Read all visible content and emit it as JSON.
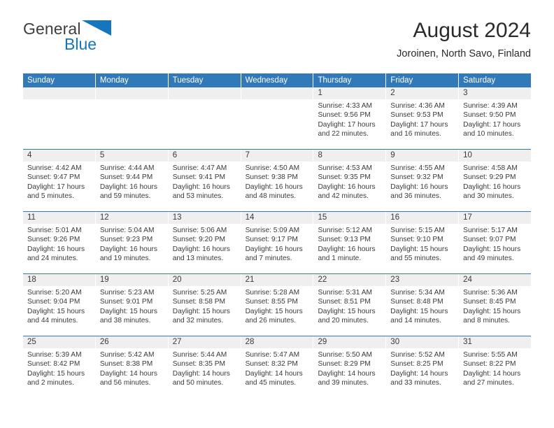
{
  "brand": {
    "name_part1": "General",
    "name_part2": "Blue",
    "triangle_color": "#1576bc"
  },
  "header": {
    "month_title": "August 2024",
    "location": "Joroinen, North Savo, Finland"
  },
  "theme": {
    "header_blue": "#3179b8",
    "daynum_band": "#efefef",
    "text": "#3a3a3a"
  },
  "weekdays": [
    "Sunday",
    "Monday",
    "Tuesday",
    "Wednesday",
    "Thursday",
    "Friday",
    "Saturday"
  ],
  "weeks": [
    [
      {
        "day": "",
        "empty": true
      },
      {
        "day": "",
        "empty": true
      },
      {
        "day": "",
        "empty": true
      },
      {
        "day": "",
        "empty": true
      },
      {
        "day": "1",
        "sunrise": "Sunrise: 4:33 AM",
        "sunset": "Sunset: 9:56 PM",
        "daylight": "Daylight: 17 hours and 22 minutes."
      },
      {
        "day": "2",
        "sunrise": "Sunrise: 4:36 AM",
        "sunset": "Sunset: 9:53 PM",
        "daylight": "Daylight: 17 hours and 16 minutes."
      },
      {
        "day": "3",
        "sunrise": "Sunrise: 4:39 AM",
        "sunset": "Sunset: 9:50 PM",
        "daylight": "Daylight: 17 hours and 10 minutes."
      }
    ],
    [
      {
        "day": "4",
        "sunrise": "Sunrise: 4:42 AM",
        "sunset": "Sunset: 9:47 PM",
        "daylight": "Daylight: 17 hours and 5 minutes."
      },
      {
        "day": "5",
        "sunrise": "Sunrise: 4:44 AM",
        "sunset": "Sunset: 9:44 PM",
        "daylight": "Daylight: 16 hours and 59 minutes."
      },
      {
        "day": "6",
        "sunrise": "Sunrise: 4:47 AM",
        "sunset": "Sunset: 9:41 PM",
        "daylight": "Daylight: 16 hours and 53 minutes."
      },
      {
        "day": "7",
        "sunrise": "Sunrise: 4:50 AM",
        "sunset": "Sunset: 9:38 PM",
        "daylight": "Daylight: 16 hours and 48 minutes."
      },
      {
        "day": "8",
        "sunrise": "Sunrise: 4:53 AM",
        "sunset": "Sunset: 9:35 PM",
        "daylight": "Daylight: 16 hours and 42 minutes."
      },
      {
        "day": "9",
        "sunrise": "Sunrise: 4:55 AM",
        "sunset": "Sunset: 9:32 PM",
        "daylight": "Daylight: 16 hours and 36 minutes."
      },
      {
        "day": "10",
        "sunrise": "Sunrise: 4:58 AM",
        "sunset": "Sunset: 9:29 PM",
        "daylight": "Daylight: 16 hours and 30 minutes."
      }
    ],
    [
      {
        "day": "11",
        "sunrise": "Sunrise: 5:01 AM",
        "sunset": "Sunset: 9:26 PM",
        "daylight": "Daylight: 16 hours and 24 minutes."
      },
      {
        "day": "12",
        "sunrise": "Sunrise: 5:04 AM",
        "sunset": "Sunset: 9:23 PM",
        "daylight": "Daylight: 16 hours and 19 minutes."
      },
      {
        "day": "13",
        "sunrise": "Sunrise: 5:06 AM",
        "sunset": "Sunset: 9:20 PM",
        "daylight": "Daylight: 16 hours and 13 minutes."
      },
      {
        "day": "14",
        "sunrise": "Sunrise: 5:09 AM",
        "sunset": "Sunset: 9:17 PM",
        "daylight": "Daylight: 16 hours and 7 minutes."
      },
      {
        "day": "15",
        "sunrise": "Sunrise: 5:12 AM",
        "sunset": "Sunset: 9:13 PM",
        "daylight": "Daylight: 16 hours and 1 minute."
      },
      {
        "day": "16",
        "sunrise": "Sunrise: 5:15 AM",
        "sunset": "Sunset: 9:10 PM",
        "daylight": "Daylight: 15 hours and 55 minutes."
      },
      {
        "day": "17",
        "sunrise": "Sunrise: 5:17 AM",
        "sunset": "Sunset: 9:07 PM",
        "daylight": "Daylight: 15 hours and 49 minutes."
      }
    ],
    [
      {
        "day": "18",
        "sunrise": "Sunrise: 5:20 AM",
        "sunset": "Sunset: 9:04 PM",
        "daylight": "Daylight: 15 hours and 44 minutes."
      },
      {
        "day": "19",
        "sunrise": "Sunrise: 5:23 AM",
        "sunset": "Sunset: 9:01 PM",
        "daylight": "Daylight: 15 hours and 38 minutes."
      },
      {
        "day": "20",
        "sunrise": "Sunrise: 5:25 AM",
        "sunset": "Sunset: 8:58 PM",
        "daylight": "Daylight: 15 hours and 32 minutes."
      },
      {
        "day": "21",
        "sunrise": "Sunrise: 5:28 AM",
        "sunset": "Sunset: 8:55 PM",
        "daylight": "Daylight: 15 hours and 26 minutes."
      },
      {
        "day": "22",
        "sunrise": "Sunrise: 5:31 AM",
        "sunset": "Sunset: 8:51 PM",
        "daylight": "Daylight: 15 hours and 20 minutes."
      },
      {
        "day": "23",
        "sunrise": "Sunrise: 5:34 AM",
        "sunset": "Sunset: 8:48 PM",
        "daylight": "Daylight: 15 hours and 14 minutes."
      },
      {
        "day": "24",
        "sunrise": "Sunrise: 5:36 AM",
        "sunset": "Sunset: 8:45 PM",
        "daylight": "Daylight: 15 hours and 8 minutes."
      }
    ],
    [
      {
        "day": "25",
        "sunrise": "Sunrise: 5:39 AM",
        "sunset": "Sunset: 8:42 PM",
        "daylight": "Daylight: 15 hours and 2 minutes."
      },
      {
        "day": "26",
        "sunrise": "Sunrise: 5:42 AM",
        "sunset": "Sunset: 8:38 PM",
        "daylight": "Daylight: 14 hours and 56 minutes."
      },
      {
        "day": "27",
        "sunrise": "Sunrise: 5:44 AM",
        "sunset": "Sunset: 8:35 PM",
        "daylight": "Daylight: 14 hours and 50 minutes."
      },
      {
        "day": "28",
        "sunrise": "Sunrise: 5:47 AM",
        "sunset": "Sunset: 8:32 PM",
        "daylight": "Daylight: 14 hours and 45 minutes."
      },
      {
        "day": "29",
        "sunrise": "Sunrise: 5:50 AM",
        "sunset": "Sunset: 8:29 PM",
        "daylight": "Daylight: 14 hours and 39 minutes."
      },
      {
        "day": "30",
        "sunrise": "Sunrise: 5:52 AM",
        "sunset": "Sunset: 8:25 PM",
        "daylight": "Daylight: 14 hours and 33 minutes."
      },
      {
        "day": "31",
        "sunrise": "Sunrise: 5:55 AM",
        "sunset": "Sunset: 8:22 PM",
        "daylight": "Daylight: 14 hours and 27 minutes."
      }
    ]
  ]
}
